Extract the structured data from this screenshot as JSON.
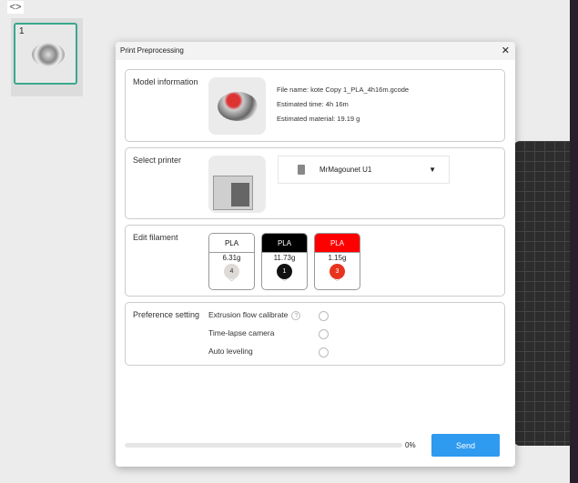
{
  "thumbnail": {
    "index": "1"
  },
  "dialog": {
    "title": "Print Preprocessing",
    "model_info": {
      "label": "Model information",
      "file_name": "File name: kote Copy 1_PLA_4h16m.gcode",
      "time": "Estimated time: 4h 16m",
      "material": "Estimated material: 19.19 g"
    },
    "printer": {
      "label": "Select printer",
      "selected": "MrMagounet U1"
    },
    "filament": {
      "label": "Edit filament",
      "items": [
        {
          "type": "PLA",
          "weight": "6.31g",
          "slot": "4",
          "color": "#ffffff",
          "slot_color": "#dddad8"
        },
        {
          "type": "PLA",
          "weight": "11.73g",
          "slot": "1",
          "color": "#000000",
          "slot_color": "#111111"
        },
        {
          "type": "PLA",
          "weight": "1.15g",
          "slot": "3",
          "color": "#ff0000",
          "slot_color": "#e8331f"
        }
      ]
    },
    "preference": {
      "label": "Preference setting",
      "options": [
        {
          "label": "Extrusion flow calibrate",
          "help": "?",
          "checked": false
        },
        {
          "label": "Time-lapse camera",
          "checked": false
        },
        {
          "label": "Auto leveling",
          "checked": false
        }
      ]
    },
    "progress": {
      "value": 0,
      "text": "0%"
    },
    "send_label": "Send"
  }
}
